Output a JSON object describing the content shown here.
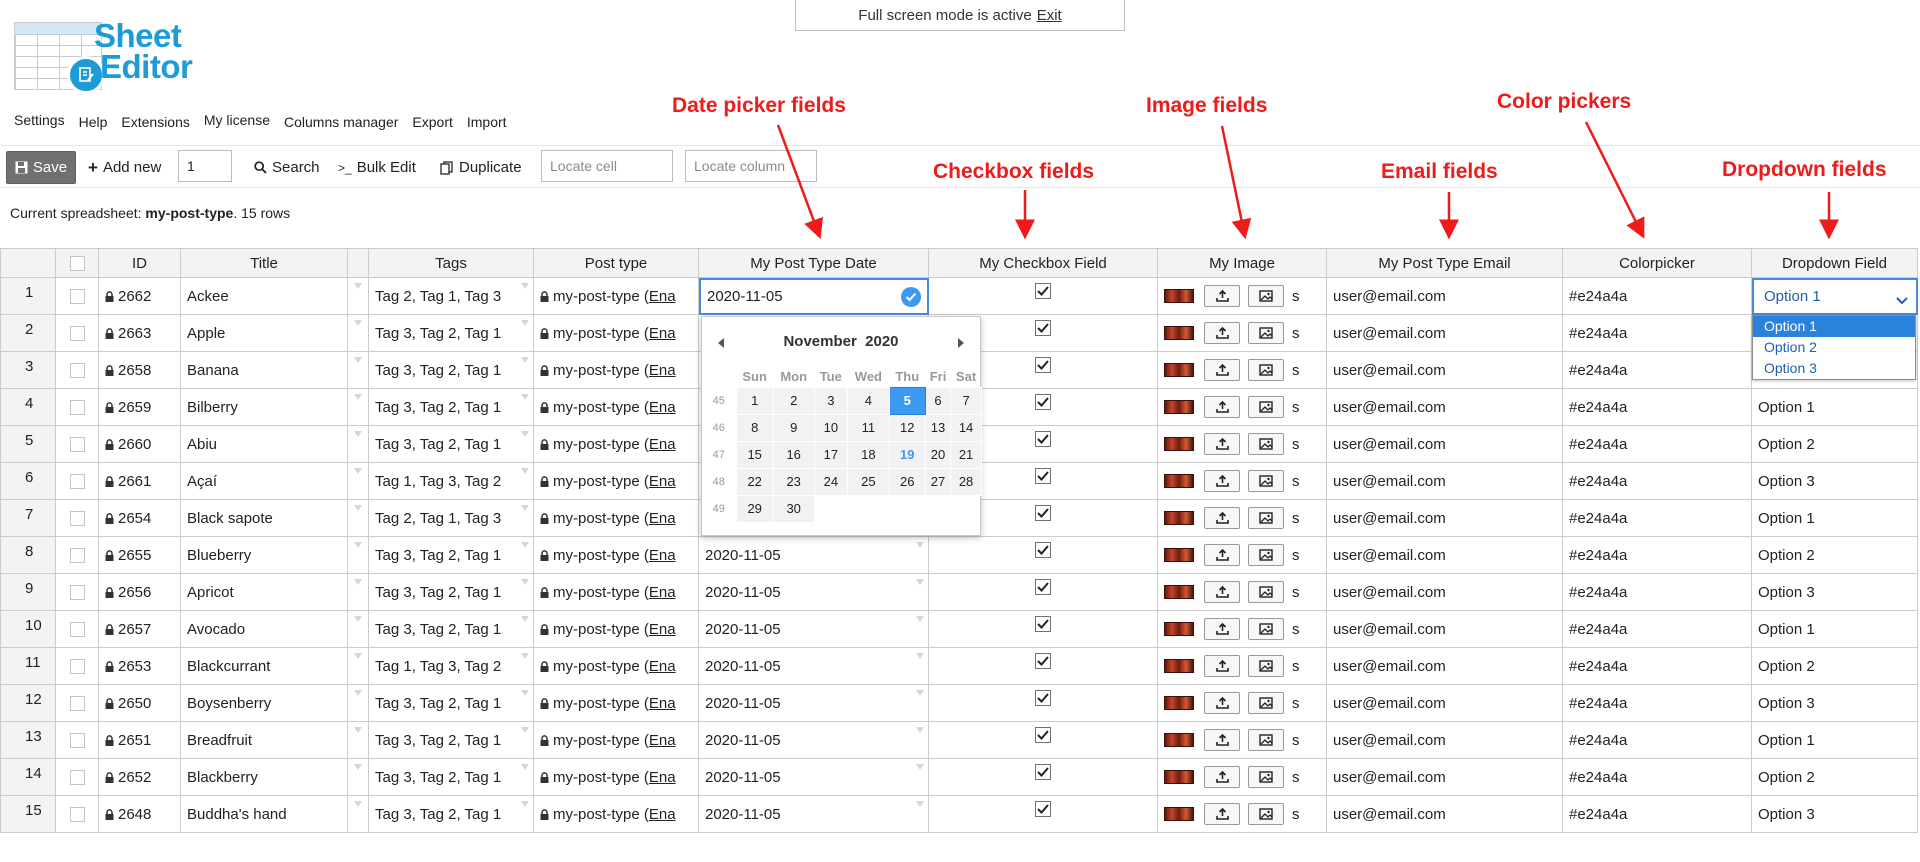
{
  "banner": {
    "text": "Full screen mode is active",
    "exit_link": "Exit"
  },
  "logo": {
    "line1": "Sheet",
    "line2": "Editor"
  },
  "menu": [
    "Settings",
    "Help",
    "Extensions",
    "My license",
    "Columns manager",
    "Export",
    "Import"
  ],
  "toolbar": {
    "save_label": "Save",
    "add_new_label": "Add new",
    "add_new_count": "1",
    "search_label": "Search",
    "bulk_edit_label": "Bulk Edit",
    "duplicate_label": "Duplicate",
    "locate_cell_placeholder": "Locate cell",
    "locate_column_placeholder": "Locate column"
  },
  "sheet_info": {
    "prefix": "Current spreadsheet:",
    "name": "my-post-type",
    "suffix": ". 15 rows"
  },
  "annotations": {
    "date": "Date picker fields",
    "checkbox": "Checkbox fields",
    "image": "Image fields",
    "email": "Email fields",
    "color": "Color pickers",
    "dropdown": "Dropdown fields"
  },
  "columns": [
    "",
    "ID",
    "Title",
    "",
    "Tags",
    "Post type",
    "My Post Type Date",
    "My Checkbox Field",
    "My Image",
    "My Post Type Email",
    "Colorpicker",
    "Dropdown Field"
  ],
  "post_type_text": "my-post-type (",
  "post_type_link": "Ena",
  "image_suffix": "s",
  "rows": [
    {
      "n": "1",
      "id": "2662",
      "title": "Ackee",
      "tags": "Tag 2, Tag 1, Tag 3",
      "date": "2020-11-05",
      "email": "user@email.com",
      "color": "#e24a4a",
      "option": "Option 1"
    },
    {
      "n": "2",
      "id": "2663",
      "title": "Apple",
      "tags": "Tag 3, Tag 2, Tag 1",
      "date": "",
      "email": "user@email.com",
      "color": "#e24a4a",
      "option": ""
    },
    {
      "n": "3",
      "id": "2658",
      "title": "Banana",
      "tags": "Tag 3, Tag 2, Tag 1",
      "date": "",
      "email": "user@email.com",
      "color": "#e24a4a",
      "option": ""
    },
    {
      "n": "4",
      "id": "2659",
      "title": "Bilberry",
      "tags": "Tag 3, Tag 2, Tag 1",
      "date": "",
      "email": "user@email.com",
      "color": "#e24a4a",
      "option": "Option 1"
    },
    {
      "n": "5",
      "id": "2660",
      "title": "Abiu",
      "tags": "Tag 3, Tag 2, Tag 1",
      "date": "",
      "email": "user@email.com",
      "color": "#e24a4a",
      "option": "Option 2"
    },
    {
      "n": "6",
      "id": "2661",
      "title": "Açaí",
      "tags": "Tag 1, Tag 3, Tag 2",
      "date": "",
      "email": "user@email.com",
      "color": "#e24a4a",
      "option": "Option 3"
    },
    {
      "n": "7",
      "id": "2654",
      "title": "Black sapote",
      "tags": "Tag 2, Tag 1, Tag 3",
      "date": "",
      "email": "user@email.com",
      "color": "#e24a4a",
      "option": "Option 1"
    },
    {
      "n": "8",
      "id": "2655",
      "title": "Blueberry",
      "tags": "Tag 3, Tag 2, Tag 1",
      "date": "2020-11-05",
      "email": "user@email.com",
      "color": "#e24a4a",
      "option": "Option 2"
    },
    {
      "n": "9",
      "id": "2656",
      "title": "Apricot",
      "tags": "Tag 3, Tag 2, Tag 1",
      "date": "2020-11-05",
      "email": "user@email.com",
      "color": "#e24a4a",
      "option": "Option 3"
    },
    {
      "n": "10",
      "id": "2657",
      "title": "Avocado",
      "tags": "Tag 3, Tag 2, Tag 1",
      "date": "2020-11-05",
      "email": "user@email.com",
      "color": "#e24a4a",
      "option": "Option 1"
    },
    {
      "n": "11",
      "id": "2653",
      "title": "Blackcurrant",
      "tags": "Tag 1, Tag 3, Tag 2",
      "date": "2020-11-05",
      "email": "user@email.com",
      "color": "#e24a4a",
      "option": "Option 2"
    },
    {
      "n": "12",
      "id": "2650",
      "title": "Boysenberry",
      "tags": "Tag 3, Tag 2, Tag 1",
      "date": "2020-11-05",
      "email": "user@email.com",
      "color": "#e24a4a",
      "option": "Option 3"
    },
    {
      "n": "13",
      "id": "2651",
      "title": "Breadfruit",
      "tags": "Tag 3, Tag 2, Tag 1",
      "date": "2020-11-05",
      "email": "user@email.com",
      "color": "#e24a4a",
      "option": "Option 1"
    },
    {
      "n": "14",
      "id": "2652",
      "title": "Blackberry",
      "tags": "Tag 3, Tag 2, Tag 1",
      "date": "2020-11-05",
      "email": "user@email.com",
      "color": "#e24a4a",
      "option": "Option 2"
    },
    {
      "n": "15",
      "id": "2648",
      "title": "Buddha's hand",
      "tags": "Tag 3, Tag 2, Tag 1",
      "date": "2020-11-05",
      "email": "user@email.com",
      "color": "#e24a4a",
      "option": "Option 3"
    }
  ],
  "dropdown_options": [
    "Option 1",
    "Option 2",
    "Option 3"
  ],
  "datepicker": {
    "month": "November",
    "year": "2020",
    "weekdays": [
      "Sun",
      "Mon",
      "Tue",
      "Wed",
      "Thu",
      "Fri",
      "Sat"
    ],
    "weeks": [
      {
        "wk": "45",
        "days": [
          "",
          "1",
          "2",
          "3",
          "4",
          "5",
          "6",
          "7"
        ]
      },
      {
        "wk": "46",
        "days": [
          "",
          "8",
          "9",
          "10",
          "11",
          "12",
          "13",
          "14"
        ]
      },
      {
        "wk": "47",
        "days": [
          "",
          "15",
          "16",
          "17",
          "18",
          "19",
          "20",
          "21"
        ]
      },
      {
        "wk": "48",
        "days": [
          "",
          "22",
          "23",
          "24",
          "25",
          "26",
          "27",
          "28"
        ]
      },
      {
        "wk": "49",
        "days": [
          "",
          "29",
          "30",
          "",
          "",
          "",
          "",
          ""
        ]
      }
    ],
    "selected_day": "5",
    "today_day": "19"
  },
  "colors": {
    "accent": "#1d9bd7",
    "annotation": "#ef1b1b",
    "selection": "#3d98f2"
  }
}
